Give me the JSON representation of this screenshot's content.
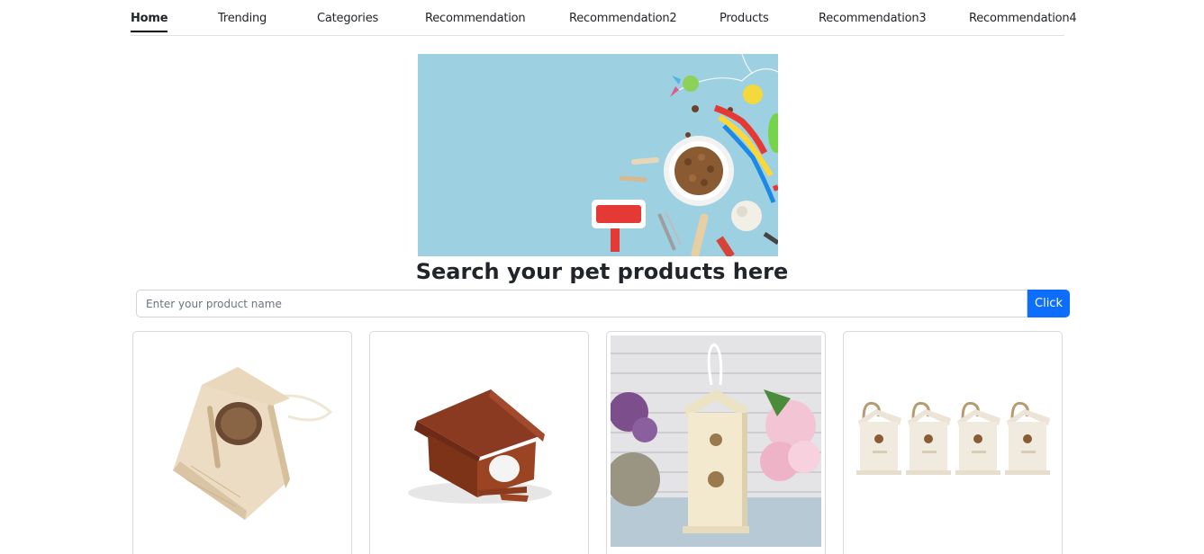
{
  "nav": {
    "items": [
      {
        "label": "Home",
        "active": true
      },
      {
        "label": "Trending"
      },
      {
        "label": "Categories"
      },
      {
        "label": "Recommendation"
      },
      {
        "label": "Recommendation2"
      },
      {
        "label": "Products"
      },
      {
        "label": "Recommendation3"
      },
      {
        "label": "Recommendation4"
      }
    ]
  },
  "hero": {
    "title": "Search your pet products here"
  },
  "search": {
    "placeholder": "Enter your product name",
    "value": "",
    "button_label": "Click"
  },
  "colors": {
    "accent": "#0d6efd",
    "banner_bg": "#9dd1e1"
  },
  "products": [
    {
      "image": "wooden-birdhouse-open-roof"
    },
    {
      "image": "brown-birdhouse-feeder"
    },
    {
      "image": "white-birdhouse-hanging"
    },
    {
      "image": "four-white-birdhouses"
    }
  ]
}
